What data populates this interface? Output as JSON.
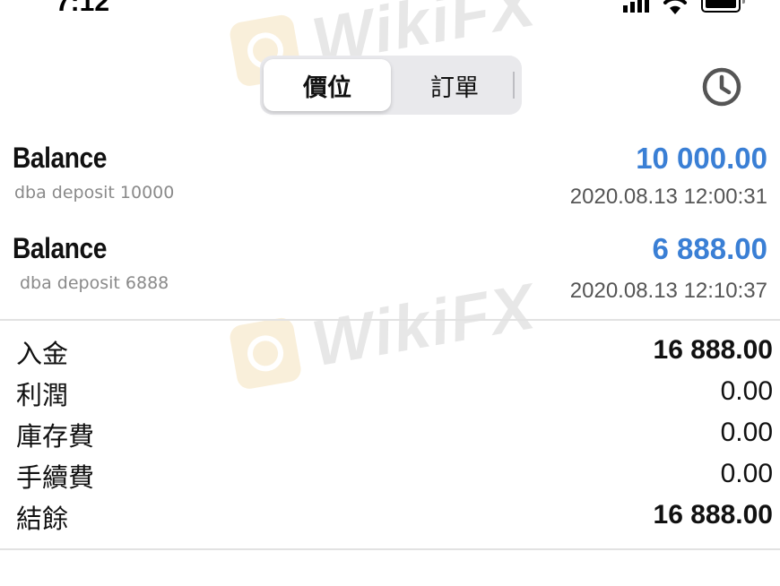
{
  "status_bar": {
    "time": "7:12"
  },
  "watermark": {
    "text": "WikiFX"
  },
  "segmented_control": {
    "tabs": [
      {
        "label": "價位",
        "active": true
      },
      {
        "label": "訂單",
        "active": false
      }
    ]
  },
  "icons": {
    "history": "clock-icon",
    "signal": "signal-icon",
    "wifi": "wifi-icon",
    "battery": "battery-icon"
  },
  "colors": {
    "amount_blue": "#3a7fd5",
    "segment_bg": "#e9e9ec"
  },
  "transactions": [
    {
      "type": "Balance",
      "comment": "dba deposit 10000",
      "amount": "10 000.00",
      "time": "2020.08.13 12:00:31"
    },
    {
      "type": "Balance",
      "comment": "dba deposit 6888",
      "amount": "6 888.00",
      "time": "2020.08.13 12:10:37"
    }
  ],
  "summary": [
    {
      "label": "入金",
      "value": "16 888.00"
    },
    {
      "label": "利潤",
      "value": "0.00"
    },
    {
      "label": "庫存費",
      "value": "0.00"
    },
    {
      "label": "手續費",
      "value": "0.00"
    },
    {
      "label": "結餘",
      "value": "16 888.00"
    }
  ]
}
